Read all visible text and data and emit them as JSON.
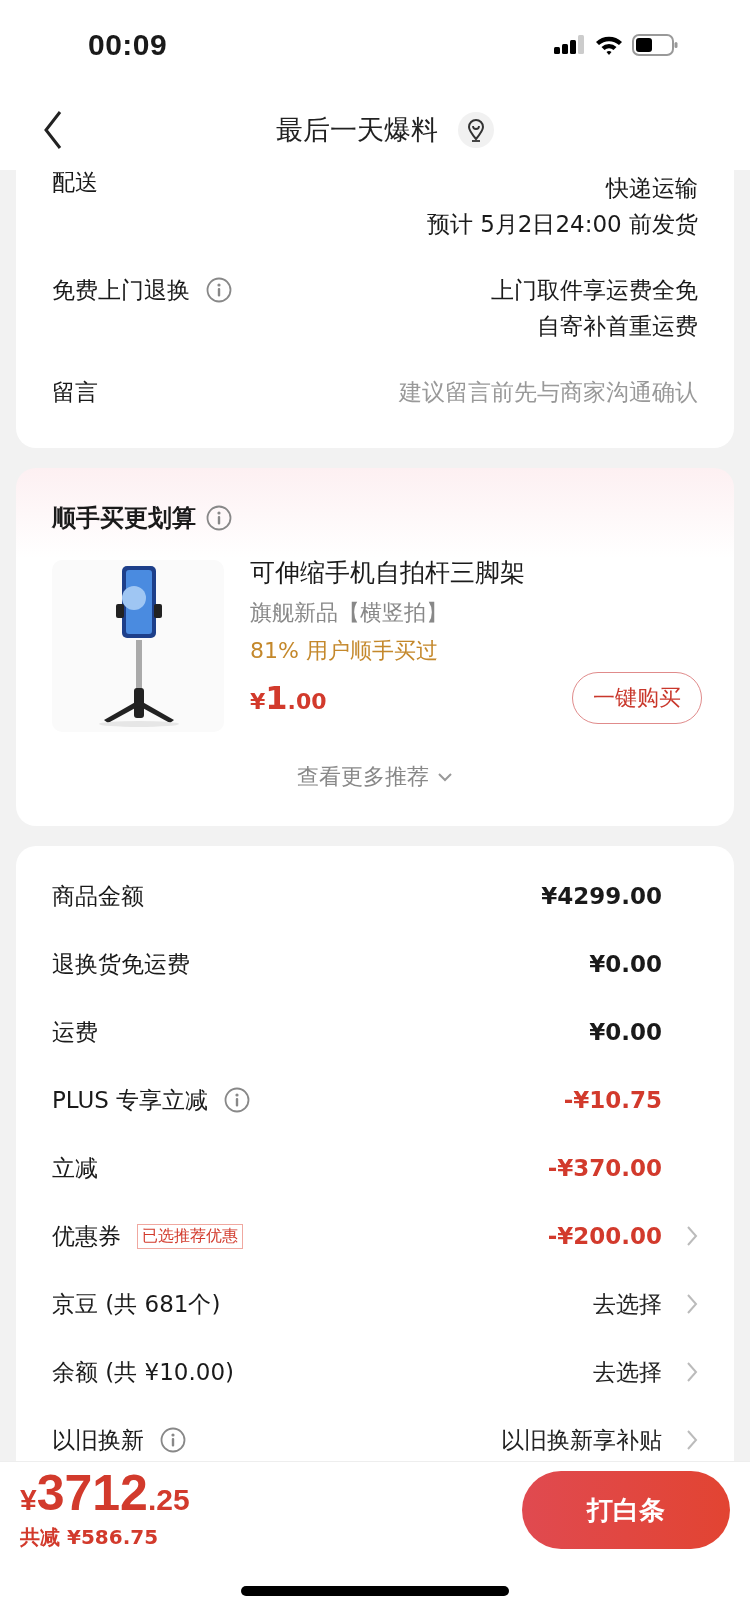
{
  "status_bar": {
    "time": "00:09"
  },
  "nav": {
    "title": "最后一天爆料"
  },
  "delivery_card": {
    "rows": [
      {
        "label": "配送",
        "info": false,
        "lines": [
          "快递运输",
          "预计 5月2日24:00 前发货"
        ],
        "muted": false
      },
      {
        "label": "免费上门退换",
        "info": true,
        "lines": [
          "上门取件享运费全免",
          "自寄补首重运费"
        ],
        "muted": false
      },
      {
        "label": "留言",
        "info": false,
        "lines": [
          "建议留言前先与商家沟通确认"
        ],
        "muted": true
      }
    ]
  },
  "addon_card": {
    "title": "顺手买更划算",
    "product": {
      "kind": "picture",
      "name": "可伸缩手机自拍杆三脚架",
      "subtitle": "旗舰新品【横竖拍】",
      "note": "81% 用户顺手买过",
      "price_currency": "¥",
      "price_integer": "1",
      "price_decimal": ".00",
      "button": "一键购买"
    },
    "more": "查看更多推荐"
  },
  "summary_card": {
    "rows": [
      {
        "label": "商品金额",
        "info": false,
        "value": "¥4299.00",
        "kind": "amount",
        "chevron": false
      },
      {
        "label": "退换货免运费",
        "info": false,
        "value": "¥0.00",
        "kind": "amount",
        "chevron": false
      },
      {
        "label": "运费",
        "info": false,
        "value": "¥0.00",
        "kind": "amount",
        "chevron": false
      },
      {
        "label": "PLUS 专享立减",
        "info": true,
        "value": "-¥10.75",
        "kind": "discount",
        "chevron": false
      },
      {
        "label": "立减",
        "info": false,
        "value": "-¥370.00",
        "kind": "discount",
        "chevron": false
      },
      {
        "label": "优惠券",
        "info": false,
        "tag": "已选推荐优惠",
        "value": "-¥200.00",
        "kind": "discount",
        "chevron": true
      },
      {
        "label": "京豆 (共 681个)",
        "info": false,
        "value": "去选择",
        "kind": "action",
        "chevron": true
      },
      {
        "label": "余额 (共 ¥10.00)",
        "info": false,
        "value": "去选择",
        "kind": "action",
        "chevron": true
      },
      {
        "label": "以旧换新",
        "info": true,
        "value": "以旧换新享补贴",
        "kind": "action",
        "chevron": true
      }
    ]
  },
  "footer": {
    "total_currency": "¥",
    "total_integer": "3712",
    "total_decimal": ".25",
    "saved": "共减 ¥586.75",
    "button": "打白条"
  }
}
